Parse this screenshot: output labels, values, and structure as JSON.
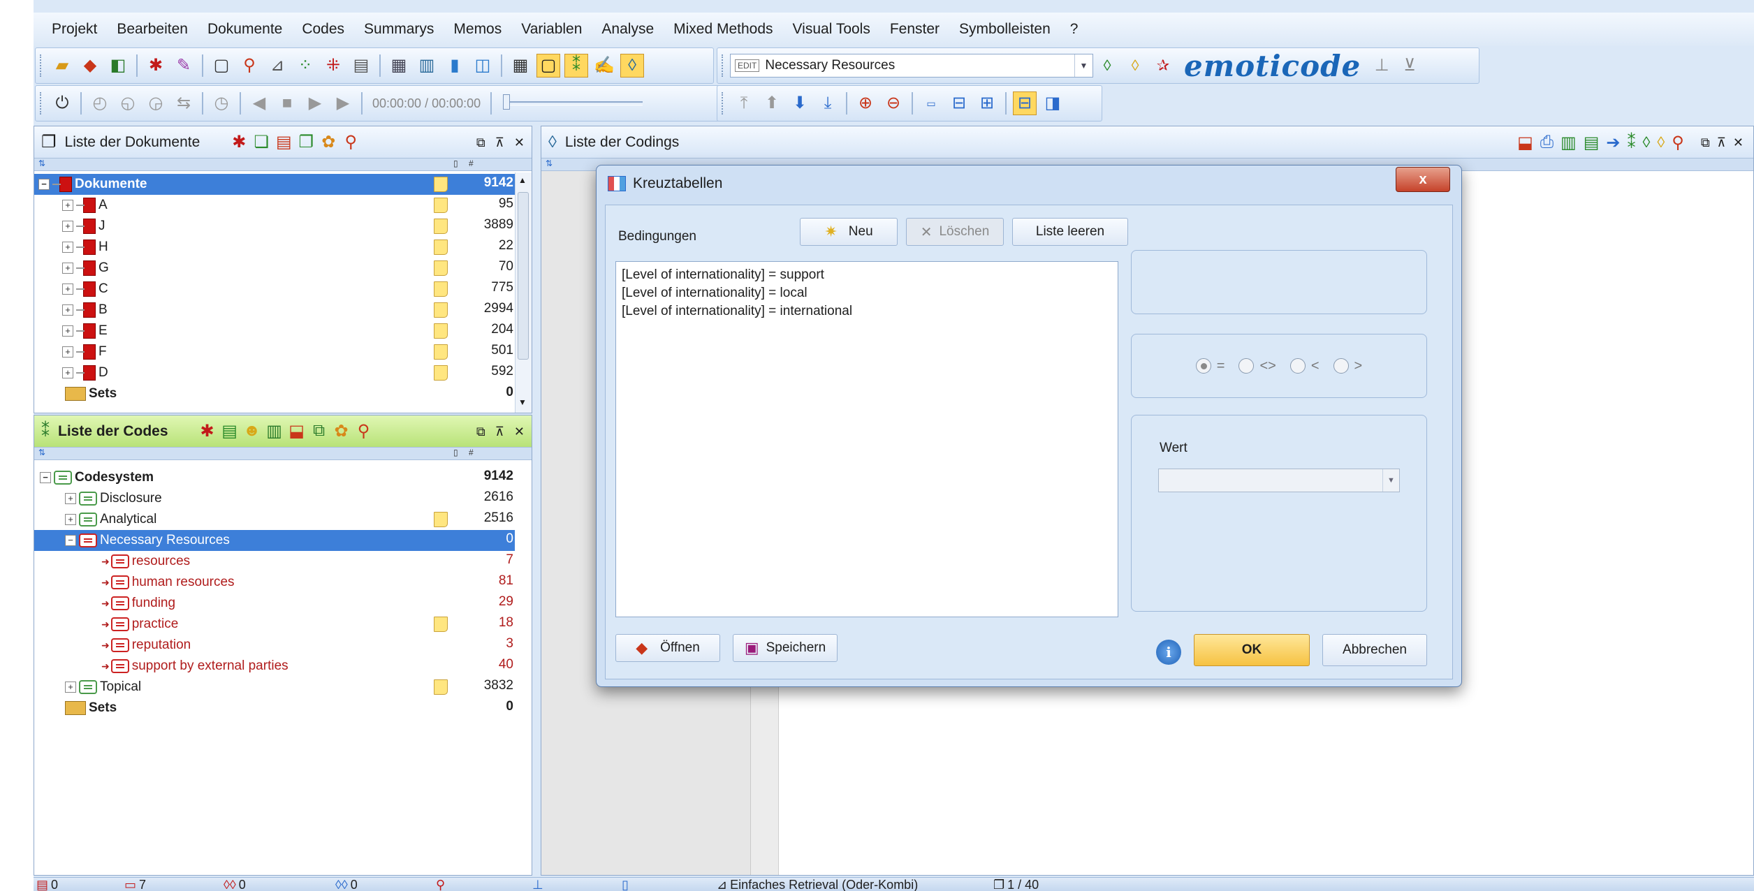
{
  "menu": [
    "Projekt",
    "Bearbeiten",
    "Dokumente",
    "Codes",
    "Summarys",
    "Memos",
    "Variablen",
    "Analyse",
    "Mixed Methods",
    "Visual Tools",
    "Fenster",
    "Symbolleisten",
    "?"
  ],
  "toolbar": {
    "code_combo_tag": "EDIT",
    "code_combo_value": "Necessary Resources",
    "brand": "emoticode",
    "time": "00:00:00 / 00:00:00"
  },
  "documents_panel": {
    "title": "Liste der Dokumente",
    "root": {
      "label": "Dokumente",
      "count": "9142"
    },
    "items": [
      {
        "label": "A",
        "count": "95"
      },
      {
        "label": "J",
        "count": "3889"
      },
      {
        "label": "H",
        "count": "22"
      },
      {
        "label": "G",
        "count": "70"
      },
      {
        "label": "C",
        "count": "775"
      },
      {
        "label": "B",
        "count": "2994"
      },
      {
        "label": "E",
        "count": "204"
      },
      {
        "label": "F",
        "count": "501"
      },
      {
        "label": "D",
        "count": "592"
      }
    ],
    "sets": {
      "label": "Sets",
      "count": "0"
    }
  },
  "codes_panel": {
    "title": "Liste der Codes",
    "root": {
      "label": "Codesystem",
      "count": "9142"
    },
    "items": [
      {
        "label": "Disclosure",
        "count": "2616"
      },
      {
        "label": "Analytical",
        "count": "2516"
      },
      {
        "label": "Necessary Resources",
        "count": "0"
      },
      {
        "label": "resources",
        "count": "7"
      },
      {
        "label": "human resources",
        "count": "81"
      },
      {
        "label": "funding",
        "count": "29"
      },
      {
        "label": "practice",
        "count": "18"
      },
      {
        "label": "reputation",
        "count": "3"
      },
      {
        "label": "support by external parties",
        "count": "40"
      },
      {
        "label": "Topical",
        "count": "3832"
      }
    ],
    "sets": {
      "label": "Sets",
      "count": "0"
    }
  },
  "codings_panel": {
    "title": "Liste der Codings"
  },
  "dialog": {
    "title": "Kreuztabellen",
    "close": "x",
    "conditions_label": "Bedingungen",
    "btn_new": "Neu",
    "btn_delete": "Löschen",
    "btn_clear": "Liste leeren",
    "conditions": [
      "[Level of internationality] = support",
      "[Level of internationality] = local",
      "[Level of internationality] = international"
    ],
    "operators": [
      "=",
      "<>",
      "<",
      ">"
    ],
    "value_label": "Wert",
    "btn_open": "Öffnen",
    "btn_save": "Speichern",
    "btn_ok": "OK",
    "btn_cancel": "Abbrechen"
  },
  "statusbar": {
    "s1": "0",
    "s2": "7",
    "s3": "0",
    "s4": "0",
    "retrieval": "Einfaches Retrieval (Oder-Kombi)",
    "page": "1 / 40"
  },
  "colors": {
    "accent": "#1a66b8",
    "selection": "#3d7fd9",
    "code_red": "#b01c1c",
    "codes_header": "#b8e278"
  }
}
